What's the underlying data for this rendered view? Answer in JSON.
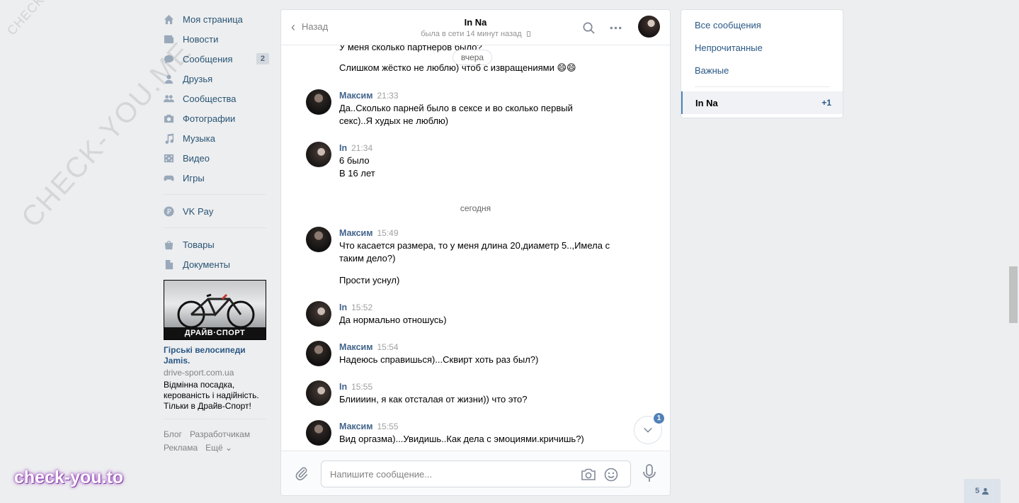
{
  "watermark": {
    "small": "CHECK-YOU.ME",
    "big": "CHECK-YOU.ME",
    "logo": "check-you.to"
  },
  "nav": {
    "items": [
      {
        "label": "Моя страница",
        "icon": "home-icon"
      },
      {
        "label": "Новости",
        "icon": "news-icon"
      },
      {
        "label": "Сообщения",
        "icon": "messages-icon",
        "count": "2"
      },
      {
        "label": "Друзья",
        "icon": "friends-icon"
      },
      {
        "label": "Сообщества",
        "icon": "communities-icon"
      },
      {
        "label": "Фотографии",
        "icon": "photos-icon"
      },
      {
        "label": "Музыка",
        "icon": "music-icon"
      },
      {
        "label": "Видео",
        "icon": "video-icon"
      },
      {
        "label": "Игры",
        "icon": "games-icon"
      }
    ],
    "vkpay": "VK Pay",
    "extra": [
      {
        "label": "Товары",
        "icon": "goods-icon"
      },
      {
        "label": "Документы",
        "icon": "documents-icon"
      }
    ]
  },
  "ad": {
    "brand": "ДРАЙВ·СПОРТ",
    "title": "Гірські велосипеди Jamis.",
    "domain": "drive-sport.com.ua",
    "description": "Відмінна посадка, керованість і надійність. Тільки в Драйв-Спорт!"
  },
  "footer": {
    "blog": "Блог",
    "developers": "Разработчикам",
    "ads": "Реклама",
    "more": "Ещё ⌄"
  },
  "chat": {
    "back": "Назад",
    "peer_name": "In Na",
    "peer_status": "была в сети 14 минут назад",
    "composer_placeholder": "Напишите сообщение...",
    "scroll_badge": "1",
    "top_partial": "У меня сколько партнеров было?",
    "date_yesterday": "вчера",
    "top_text": "Слишком жёстко не люблю) чтоб с извращениями 😄😄",
    "date_today": "сегодня",
    "messages": [
      {
        "author": "Максим",
        "time": "21:33",
        "lines": [
          "Да..Сколько парней было в сексе и во сколько первый",
          "секс)..Я худых не люблю)"
        ]
      },
      {
        "author": "In",
        "time": "21:34",
        "lines": [
          "6 было",
          "В 16 лет"
        ]
      },
      {
        "author": "Максим",
        "time": "15:49",
        "lines": [
          "Что касается размера, то у меня длина 20,диаметр 5..,Имела с",
          "таким дело?)"
        ],
        "extra": "Прости уснул)"
      },
      {
        "author": "In",
        "time": "15:52",
        "lines": [
          "Да нормально отношусь)"
        ]
      },
      {
        "author": "Максим",
        "time": "15:54",
        "lines": [
          "Надеюсь справишься)...Сквирт хоть раз был?)"
        ]
      },
      {
        "author": "In",
        "time": "15:55",
        "lines": [
          "Блиииин, я как отсталая от жизни)) что это?"
        ]
      },
      {
        "author": "Максим",
        "time": "15:55",
        "lines": [
          "Вид оргазма)...Увидишь..Как дела с эмоциями.кричишь?)"
        ]
      }
    ]
  },
  "right": {
    "all": "Все сообщения",
    "unread": "Непрочитанные",
    "important": "Важные",
    "conv_name": "In Na",
    "conv_count": "+1"
  },
  "online": {
    "count": "5"
  }
}
